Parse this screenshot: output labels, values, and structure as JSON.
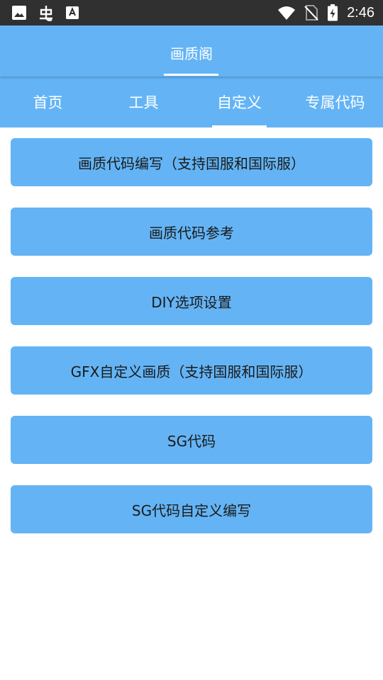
{
  "status_bar": {
    "time": "2:46",
    "icons_left": [
      "image-icon",
      "bug-icon",
      "font-icon"
    ],
    "icons_right": [
      "wifi-icon",
      "no-sim-icon",
      "battery-charging-icon"
    ]
  },
  "header": {
    "title": "画质阁"
  },
  "tabs": [
    {
      "label": "首页"
    },
    {
      "label": "工具"
    },
    {
      "label": "自定义"
    },
    {
      "label": "专属代码"
    }
  ],
  "active_tab": 2,
  "menu": [
    {
      "label": "画质代码编写（支持国服和国际服）"
    },
    {
      "label": "画质代码参考"
    },
    {
      "label": "DIY选项设置"
    },
    {
      "label": "GFX自定义画质（支持国服和国际服）"
    },
    {
      "label": "SG代码"
    },
    {
      "label": "SG代码自定义编写"
    }
  ],
  "colors": {
    "accent": "#64b4f5",
    "status_bar": "#303030",
    "button_text": "#1a1a1a"
  }
}
